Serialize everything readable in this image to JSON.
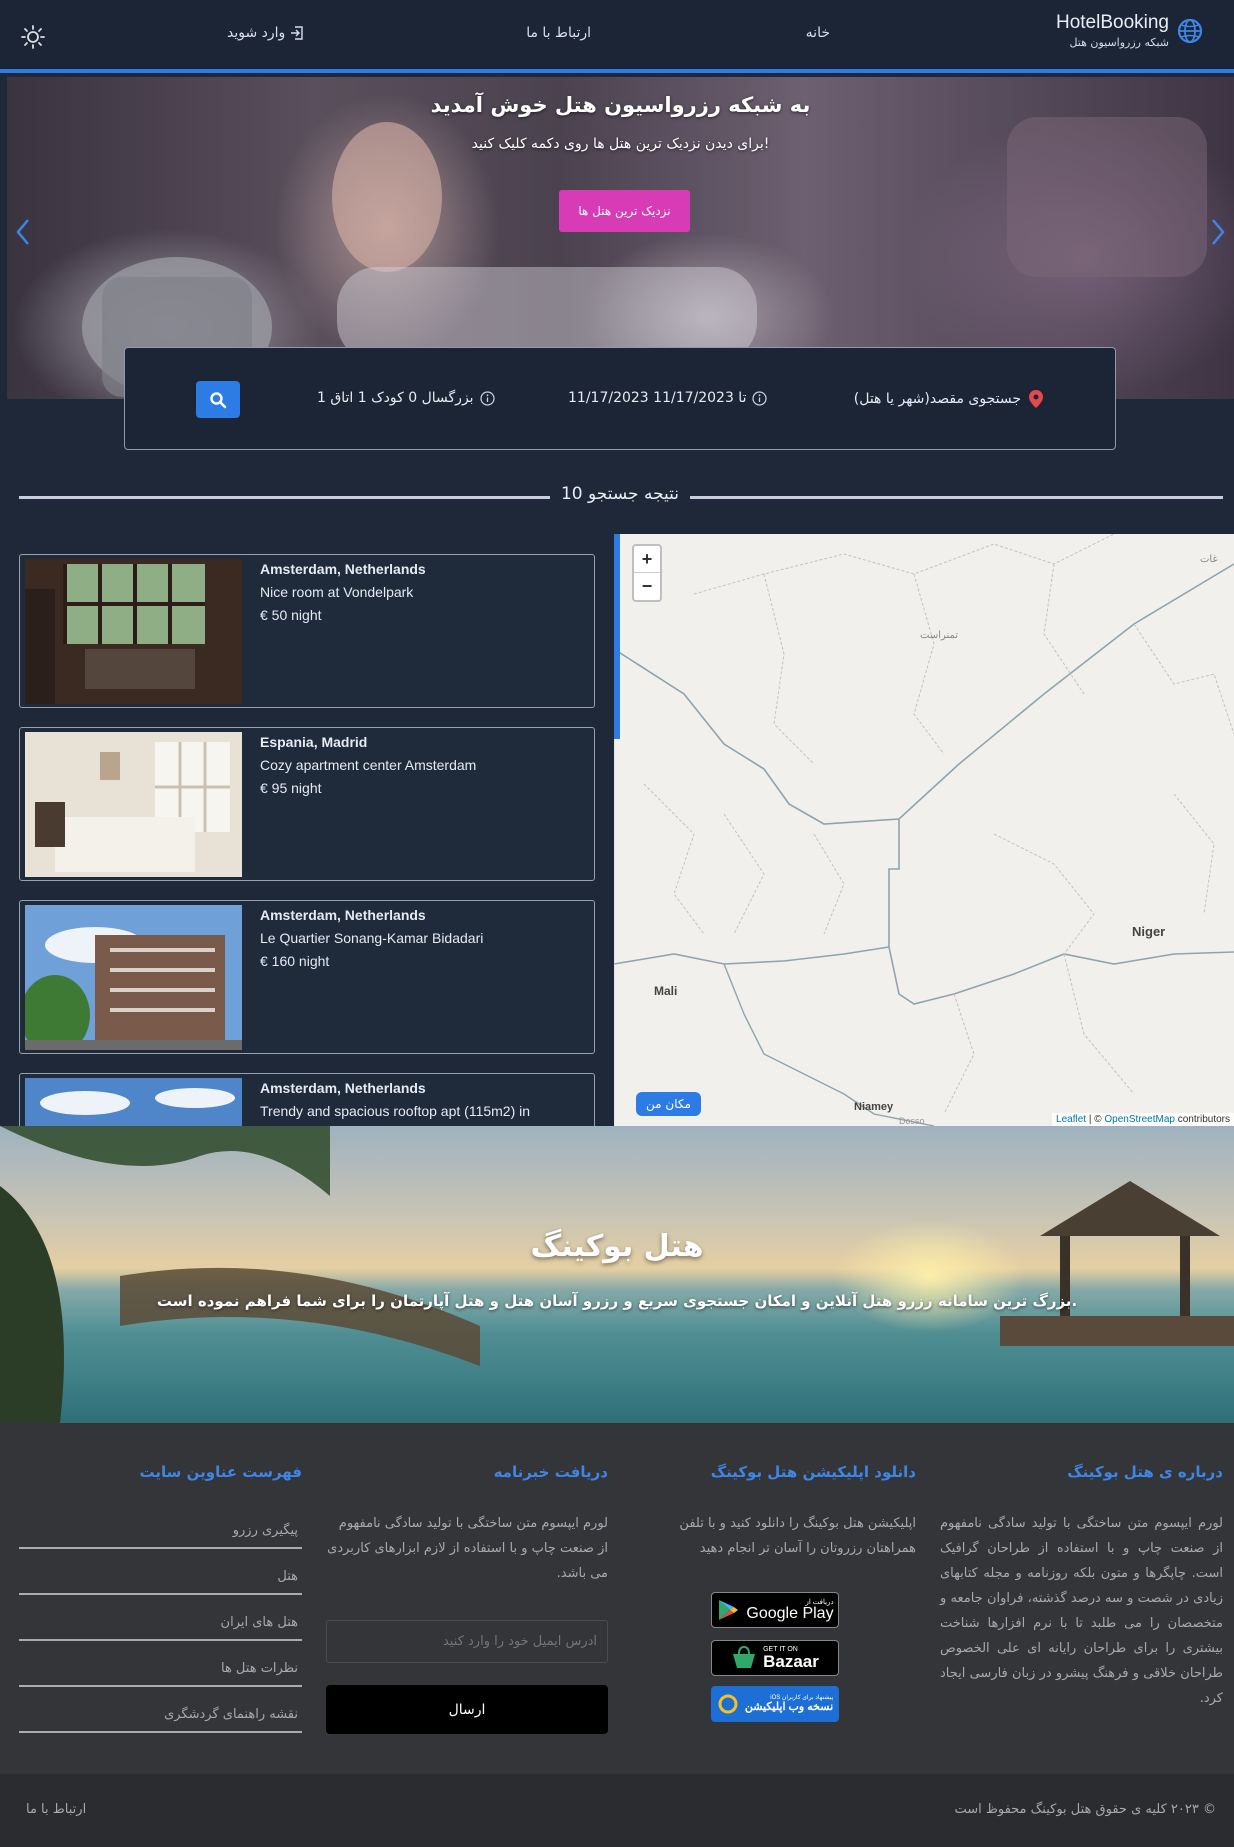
{
  "header": {
    "logo_title": "HotelBooking",
    "logo_subtitle": "شبکه رزرواسیون هتل",
    "nav_home": "خانه",
    "nav_contact": "ارتباط با ما",
    "nav_login": "وارد شوید",
    "accent_color": "#2d7be5"
  },
  "hero": {
    "title": "به شبکه رزرواسیون هتل خوش آمدید",
    "subtitle": "برای دیدن نزدیک ترین هتل ها روی دکمه کلیک کنید!",
    "button_label": "نزدیک ترین هتل ها",
    "button_color": "#d83bb6"
  },
  "search": {
    "destination_placeholder": "جستجوی مقصد(شهر یا هتل)",
    "dates": "11/17/2023 تا 11/17/2023",
    "guests": "1 بزرگسال 0 کودک 1 اتاق",
    "search_icon": "search-icon"
  },
  "results": {
    "title": "10 نتیجه جستجو",
    "items": [
      {
        "location": "Amsterdam, Netherlands",
        "name": "Nice room at Vondelpark",
        "price": "€ 50 night"
      },
      {
        "location": "Espania, Madrid",
        "name": "Cozy apartment center Amsterdam",
        "price": "€ 95 night"
      },
      {
        "location": "Amsterdam, Netherlands",
        "name": "Le Quartier Sonang-Kamar Bidadari",
        "price": "€ 160 night"
      },
      {
        "location": "Amsterdam, Netherlands",
        "name": "Trendy and spacious rooftop apt (115m2) in",
        "price": ""
      }
    ]
  },
  "map": {
    "zoom_in": "+",
    "zoom_out": "−",
    "labels": {
      "niger": "Niger",
      "mali": "Mali",
      "niamey": "Niamey",
      "dosso": "Dosso",
      "tamanrasset": "تمنراست",
      "ghat": "غات"
    },
    "my_location_button": "مکان من",
    "attribution_leaflet": "Leaflet",
    "attribution_sep": " | © ",
    "attribution_osm": "OpenStreetMap",
    "attribution_contrib": " contributors"
  },
  "promo": {
    "title": "هتل بوکینگ",
    "subtitle": "بزرگ ترین سامانه رزرو هتل آنلاین و امکان جستجوی سریع و رزرو آسان هتل و هتل آپارتمان را برای شما فراهم نموده است."
  },
  "footer": {
    "about": {
      "heading": "درباره ی هتل بوکینگ",
      "text": "لورم ایپسوم متن ساختگی با تولید سادگی نامفهوم از صنعت چاپ و با استفاده از طراحان گرافیک است. چاپگرها و متون بلکه روزنامه و مجله کتابهای زیادی در شصت و سه درصد گذشته، فراوان جامعه و متخصصان را می طلبد تا با نرم افزارها شناخت بیشتری را برای طراحان رایانه ای علی الخصوص طراحان خلاقی و فرهنگ پیشرو در زبان فارسی ایجاد کرد."
    },
    "app": {
      "heading": "دانلود اپلیکیشن هتل بوکینگ",
      "text": "اپلیکیشن هتل بوکینگ را دانلود کنید و با تلفن همراهتان رزروتان را آسان تر انجام دهید",
      "google_play_small": "دریافت از",
      "google_play": "Google Play",
      "bazaar_small": "GET IT ON",
      "bazaar": "Bazaar",
      "webapp_small": "پیشنهاد برای کاربران iOS",
      "webapp": "نسخه وب اپلیکیشن"
    },
    "newsletter": {
      "heading": "دریافت خبرنامه",
      "text": "لورم ایپسوم متن ساختگی با تولید سادگی نامفهوم از صنعت چاپ و با استفاده از لازم ابزارهای کاربردی می باشد.",
      "email_placeholder": "آدرس ایمیل خود را وارد کنید",
      "send_button": "ارسال"
    },
    "links": {
      "heading": "فهرست عناوین سایت",
      "items": [
        "پیگیری رزرو",
        "هتل",
        "هتل های ایران",
        "نظرات هتل ها",
        "نقشه راهنمای گردشگری"
      ]
    }
  },
  "copyright": {
    "text": "© ۲۰۲۳ کلیه ی حقوق هتل بوکینگ محفوظ است",
    "contact": "ارتباط با ما"
  }
}
